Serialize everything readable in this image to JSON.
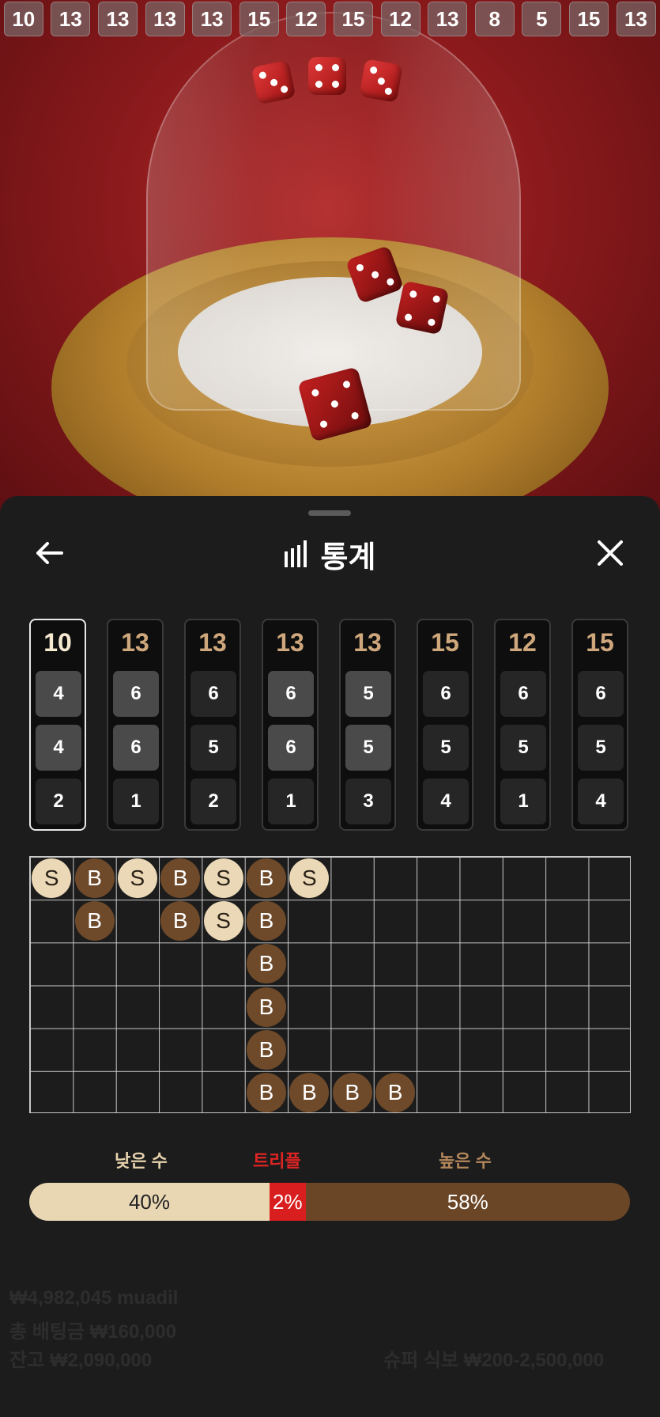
{
  "history_strip": [
    10,
    13,
    13,
    13,
    13,
    15,
    12,
    15,
    12,
    13,
    8,
    5,
    15,
    13
  ],
  "sheet": {
    "title": "통계",
    "back_icon": "arrow-left-icon",
    "close_icon": "close-icon",
    "stats_icon": "bar-chart-icon"
  },
  "rolls": [
    {
      "total": 10,
      "dice": [
        4,
        4,
        2
      ],
      "highlight": [
        true,
        true,
        false
      ],
      "active": true
    },
    {
      "total": 13,
      "dice": [
        6,
        6,
        1
      ],
      "highlight": [
        true,
        true,
        false
      ],
      "active": false
    },
    {
      "total": 13,
      "dice": [
        6,
        5,
        2
      ],
      "highlight": [
        false,
        false,
        false
      ],
      "active": false
    },
    {
      "total": 13,
      "dice": [
        6,
        6,
        1
      ],
      "highlight": [
        true,
        true,
        false
      ],
      "active": false
    },
    {
      "total": 13,
      "dice": [
        5,
        5,
        3
      ],
      "highlight": [
        true,
        true,
        false
      ],
      "active": false
    },
    {
      "total": 15,
      "dice": [
        6,
        5,
        4
      ],
      "highlight": [
        false,
        false,
        false
      ],
      "active": false
    },
    {
      "total": 12,
      "dice": [
        6,
        5,
        1
      ],
      "highlight": [
        false,
        false,
        false
      ],
      "active": false
    },
    {
      "total": 15,
      "dice": [
        6,
        5,
        4
      ],
      "highlight": [
        false,
        false,
        false
      ],
      "active": false
    }
  ],
  "road": {
    "cols": 14,
    "rows": 6,
    "beads": [
      {
        "c": 0,
        "r": 0,
        "v": "S"
      },
      {
        "c": 1,
        "r": 0,
        "v": "B"
      },
      {
        "c": 2,
        "r": 0,
        "v": "S"
      },
      {
        "c": 3,
        "r": 0,
        "v": "B"
      },
      {
        "c": 4,
        "r": 0,
        "v": "S"
      },
      {
        "c": 5,
        "r": 0,
        "v": "B"
      },
      {
        "c": 6,
        "r": 0,
        "v": "S"
      },
      {
        "c": 1,
        "r": 1,
        "v": "B"
      },
      {
        "c": 3,
        "r": 1,
        "v": "B"
      },
      {
        "c": 4,
        "r": 1,
        "v": "S"
      },
      {
        "c": 5,
        "r": 1,
        "v": "B"
      },
      {
        "c": 5,
        "r": 2,
        "v": "B"
      },
      {
        "c": 5,
        "r": 3,
        "v": "B"
      },
      {
        "c": 5,
        "r": 4,
        "v": "B"
      },
      {
        "c": 5,
        "r": 5,
        "v": "B"
      },
      {
        "c": 6,
        "r": 5,
        "v": "B"
      },
      {
        "c": 7,
        "r": 5,
        "v": "B"
      },
      {
        "c": 8,
        "r": 5,
        "v": "B"
      }
    ]
  },
  "legend": {
    "low": "낮은 수",
    "triple": "트리플",
    "high": "높은 수"
  },
  "percentages": {
    "low": 40,
    "triple": 2,
    "high": 58,
    "low_label": "40%",
    "triple_label": "2%",
    "high_label": "58%"
  },
  "ghost_footer": {
    "line1": "₩4,982,045 muadil",
    "line2": "총 배팅금 ₩160,000",
    "line3": "잔고 ₩2,090,000",
    "right3": "슈퍼 식보 ₩200-2,500,000"
  }
}
